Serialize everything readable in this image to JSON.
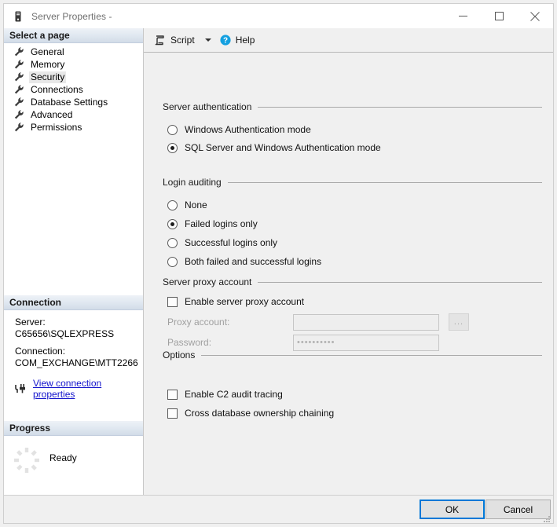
{
  "window": {
    "title": "Server Properties -",
    "icon": "server-icon",
    "controls": {
      "minimize": "minimize-icon",
      "maximize": "maximize-icon",
      "close": "close-icon"
    }
  },
  "sidebar": {
    "select_page_header": "Select a page",
    "pages": [
      {
        "label": "General",
        "selected": false
      },
      {
        "label": "Memory",
        "selected": false
      },
      {
        "label": "Security",
        "selected": true
      },
      {
        "label": "Connections",
        "selected": false
      },
      {
        "label": "Database Settings",
        "selected": false
      },
      {
        "label": "Advanced",
        "selected": false
      },
      {
        "label": "Permissions",
        "selected": false
      }
    ],
    "connection": {
      "header": "Connection",
      "server_label": "Server:",
      "server_value": "C65656\\SQLEXPRESS",
      "connection_label": "Connection:",
      "connection_value": "COM_EXCHANGE\\MTT2266",
      "link_text": "View connection properties",
      "link_color": "#1414cc"
    },
    "progress": {
      "header": "Progress",
      "status": "Ready",
      "spinner": "loading-spinner-icon"
    }
  },
  "toolbar": {
    "script_label": "Script",
    "script_icon": "script-icon",
    "dropdown_icon": "chevron-down-icon",
    "help_label": "Help",
    "help_icon": "help-question-icon"
  },
  "main": {
    "server_authentication": {
      "title": "Server authentication",
      "options": [
        {
          "label": "Windows Authentication mode",
          "checked": false
        },
        {
          "label": "SQL Server and Windows Authentication mode",
          "checked": true
        }
      ]
    },
    "login_auditing": {
      "title": "Login auditing",
      "options": [
        {
          "label": "None",
          "checked": false
        },
        {
          "label": "Failed logins only",
          "checked": true
        },
        {
          "label": "Successful logins only",
          "checked": false
        },
        {
          "label": "Both failed and successful logins",
          "checked": false
        }
      ]
    },
    "server_proxy_account": {
      "title": "Server proxy account",
      "enable_label": "Enable server proxy account",
      "enable_checked": false,
      "proxy_account_label": "Proxy account:",
      "proxy_account_value": "",
      "browse_label": "...",
      "password_label": "Password:",
      "password_value": "••••••••••"
    },
    "options": {
      "title": "Options",
      "items": [
        {
          "label": "Enable C2 audit tracing",
          "checked": false
        },
        {
          "label": "Cross database ownership chaining",
          "checked": false
        }
      ]
    }
  },
  "footer": {
    "ok_label": "OK",
    "cancel_label": "Cancel",
    "accent_color": "#0078d7"
  }
}
